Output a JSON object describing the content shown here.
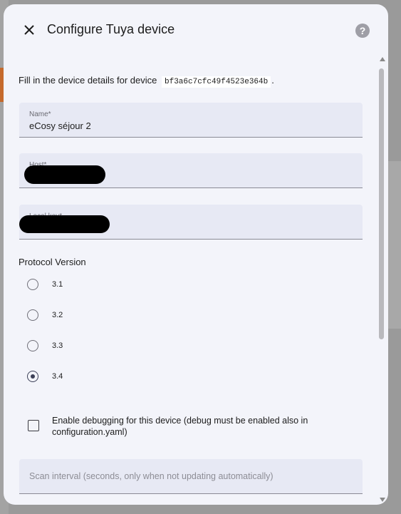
{
  "dialog": {
    "title": "Configure Tuya device",
    "close_icon": "close-icon",
    "help_icon": "help-circle-icon",
    "help_glyph": "?"
  },
  "description": {
    "prefix": "Fill in the device details for device",
    "device_id": "bf3a6c7cfc49f4523e364b",
    "suffix": "."
  },
  "fields": {
    "name": {
      "label": "Name*",
      "value": "eCosy séjour 2"
    },
    "host": {
      "label": "Host*",
      "value": ""
    },
    "local_key": {
      "label": "Local key*",
      "value": ""
    },
    "scan_interval": {
      "placeholder": "Scan interval (seconds, only when not updating automatically)",
      "value": ""
    }
  },
  "protocol": {
    "label": "Protocol Version",
    "options": [
      "3.1",
      "3.2",
      "3.3",
      "3.4"
    ],
    "selected": "3.4"
  },
  "debug": {
    "label": "Enable debugging for this device (debug must be enabled also in configuration.yaml)",
    "checked": false
  },
  "colors": {
    "dialog_bg": "#f3f4fa",
    "field_bg": "#e7e9f4",
    "accent": "#3c4057",
    "redaction": "#000000"
  }
}
